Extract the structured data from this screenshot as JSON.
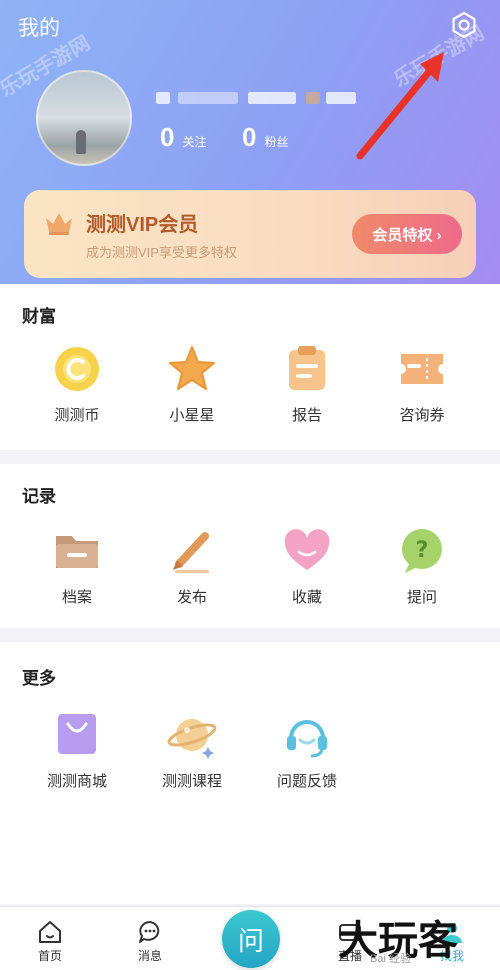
{
  "header": {
    "title": "我的",
    "stats": [
      {
        "value": "0",
        "label": "关注"
      },
      {
        "value": "0",
        "label": "粉丝"
      }
    ]
  },
  "vip": {
    "title": "测测VIP会员",
    "subtitle": "成为测测VIP享受更多特权",
    "button": "会员特权 ›"
  },
  "sections": {
    "wealth": {
      "title": "财富",
      "items": [
        {
          "label": "测测币",
          "icon": "coin-icon"
        },
        {
          "label": "小星星",
          "icon": "star-icon"
        },
        {
          "label": "报告",
          "icon": "report-icon"
        },
        {
          "label": "咨询券",
          "icon": "ticket-icon"
        }
      ]
    },
    "records": {
      "title": "记录",
      "items": [
        {
          "label": "档案",
          "icon": "folder-icon"
        },
        {
          "label": "发布",
          "icon": "pen-icon"
        },
        {
          "label": "收藏",
          "icon": "heart-icon"
        },
        {
          "label": "提问",
          "icon": "question-icon"
        }
      ]
    },
    "more": {
      "title": "更多",
      "items": [
        {
          "label": "测测商城",
          "icon": "shopping-bag-icon"
        },
        {
          "label": "测测课程",
          "icon": "planet-icon"
        },
        {
          "label": "问题反馈",
          "icon": "headset-icon"
        }
      ]
    }
  },
  "tabbar": {
    "tabs": [
      {
        "label": "首页",
        "icon": "home-icon"
      },
      {
        "label": "消息",
        "icon": "message-icon"
      },
      {
        "label": "问",
        "icon": "ask-icon"
      },
      {
        "label": "直播",
        "icon": "live-icon"
      },
      {
        "label": "找我",
        "icon": "user-icon"
      }
    ]
  },
  "watermarks": {
    "top": "乐玩手游网",
    "brand": "大玩客",
    "baidu": "Bai 经验"
  },
  "colors": {
    "header_start": "#8fb3f6",
    "header_end": "#a58cf2",
    "vip_text": "#b25a2a",
    "vip_button": "#ee6a8a",
    "ask_button": "#25a6c4",
    "arrow": "#e8322a"
  }
}
